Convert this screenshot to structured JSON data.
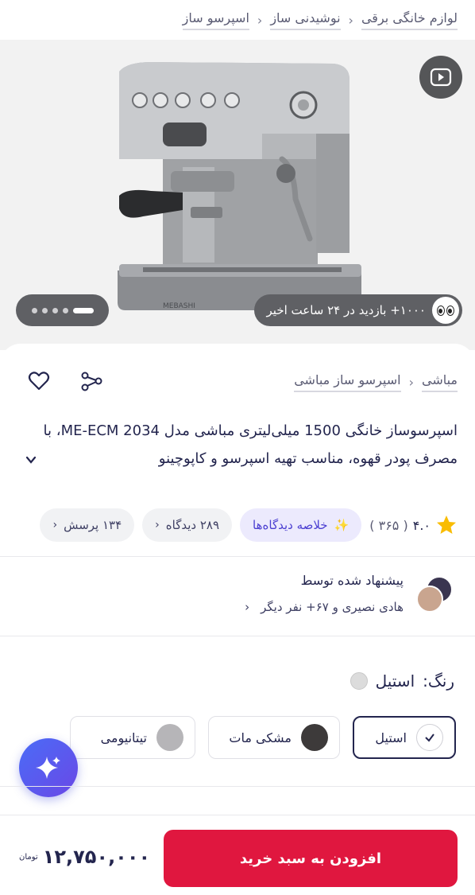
{
  "breadcrumbs": [
    "لوازم خانگی برقی",
    "نوشیدنی ساز",
    "اسپرسو ساز"
  ],
  "gallery": {
    "visits": "۱۰۰۰+ بازدید در ۲۴ ساعت اخیر",
    "image_count": 5,
    "active_index": 0
  },
  "product": {
    "breadcrumbs": [
      "مباشی",
      "اسپرسو ساز مباشی"
    ],
    "title": "اسپرسوساز خانگی 1500 میلی‌لیتری مباشی مدل ME-ECM 2034، با مصرف پودر قهوه، مناسب تهیه اسپرسو و کاپوچینو",
    "rating": "۴.۰",
    "rating_count": "( ۳۶۵ )",
    "ai_summary": "خلاصه دیدگاه‌ها",
    "reviews": "۲۸۹ دیدگاه",
    "questions": "۱۳۴ پرسش"
  },
  "recommendation": {
    "title": "پیشنهاد شده توسط",
    "names": "هادی نصیری و ۶۷+ نفر دیگر"
  },
  "color": {
    "label": "رنگ:",
    "selected": "استیل",
    "options": [
      {
        "name": "استیل",
        "hex": "#ffffff"
      },
      {
        "name": "مشکی مات",
        "hex": "#3d3a3a"
      },
      {
        "name": "تیتانیومی",
        "hex": "#b6b5b8"
      }
    ]
  },
  "cta": {
    "add_to_cart": "افزودن به سبد خرید",
    "price": "۱۲,۷۵۰,۰۰۰",
    "currency": "تومان"
  },
  "colors": {
    "accent": "#e0173f",
    "primary_text": "#23254e",
    "ai": "#4b3fd1"
  }
}
